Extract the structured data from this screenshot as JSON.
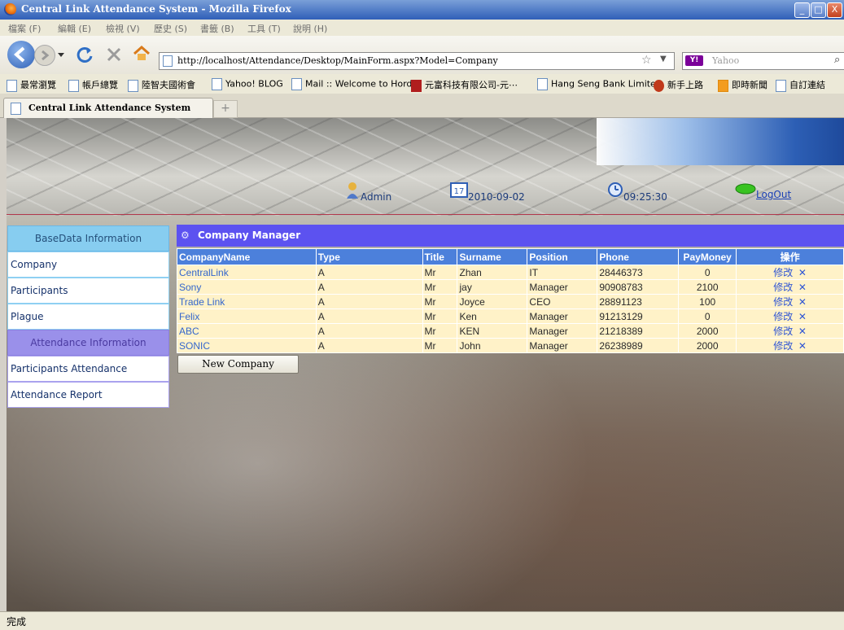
{
  "window": {
    "title": "Central Link Attendance System - Mozilla Firefox",
    "buttons": [
      "_",
      "□",
      "X"
    ]
  },
  "menu": [
    "檔案 (F)",
    "編輯 (E)",
    "檢視 (V)",
    "歷史 (S)",
    "書籤 (B)",
    "工具 (T)",
    "說明 (H)"
  ],
  "address": {
    "url": "http://localhost/Attendance/Desktop/MainForm.aspx?Model=Company"
  },
  "search": {
    "placeholder": "Yahoo",
    "engine_icon": "Y!"
  },
  "bookmarks": [
    "最常瀏覽",
    "帳戶總覽",
    "陸智夫國術會",
    "Yahoo! BLOG",
    "Mail :: Welcome to Horde",
    "元富科技有限公司-元⋯",
    "Hang Seng Bank Limited",
    "新手上路",
    "即時新聞",
    "自訂連結"
  ],
  "tab": {
    "label": "Central Link Attendance System",
    "new_tab": "+"
  },
  "header": {
    "user": "Admin",
    "date": "2010-09-02",
    "time": "09:25:30",
    "logout": "LogOut",
    "calendar_badge": "17"
  },
  "sidebar": {
    "base_header": "BaseData Information",
    "base_items": [
      "Company",
      "Participants",
      "Plague"
    ],
    "attendance_header": "Attendance Information",
    "attendance_items": [
      "Participants Attendance",
      "Attendance Report"
    ]
  },
  "grid": {
    "title": "Company Manager",
    "columns": [
      "CompanyName",
      "Type",
      "Title",
      "Surname",
      "Position",
      "Phone",
      "PayMoney",
      "操作"
    ],
    "rows": [
      [
        "CentralLink",
        "A",
        "Mr",
        "Zhan",
        "IT",
        "28446373",
        "0"
      ],
      [
        "Sony",
        "A",
        "Mr",
        "jay",
        "Manager",
        "90908783",
        "2100"
      ],
      [
        "Trade Link",
        "A",
        "Mr",
        "Joyce",
        "CEO",
        "28891123",
        "100"
      ],
      [
        "Felix",
        "A",
        "Mr",
        "Ken",
        "Manager",
        "91213129",
        "0"
      ],
      [
        "ABC",
        "A",
        "Mr",
        "KEN",
        "Manager",
        "21218389",
        "2000"
      ],
      [
        "SONIC",
        "A",
        "Mr",
        "John",
        "Manager",
        "26238989",
        "2000"
      ]
    ],
    "edit_label": "修改",
    "delete_label": "✕",
    "new_button": "New Company"
  },
  "status": {
    "text": "完成"
  }
}
